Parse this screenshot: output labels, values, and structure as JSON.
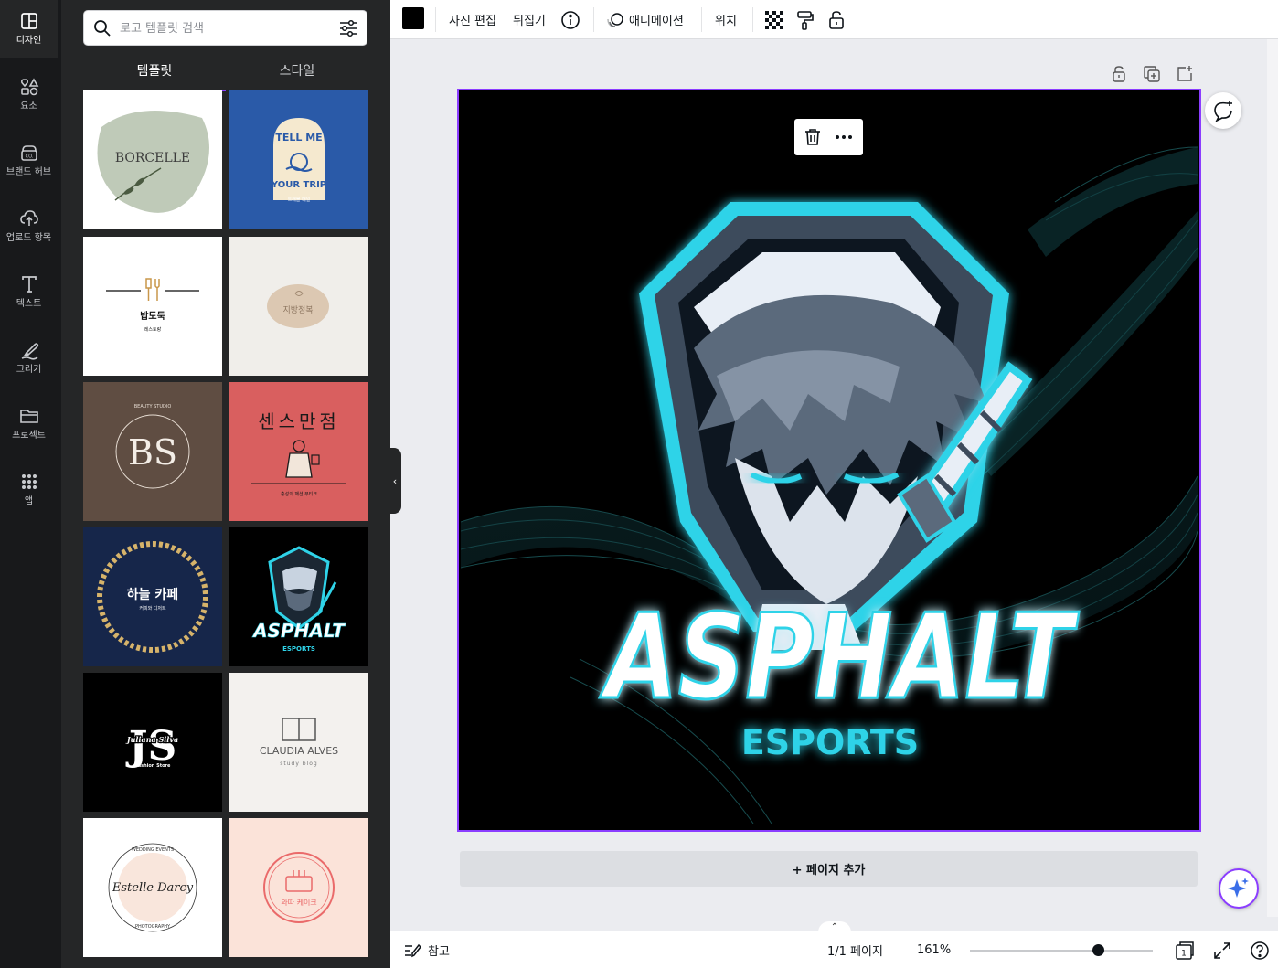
{
  "rail": {
    "items": [
      {
        "label": "디자인",
        "icon": "design-icon",
        "active": true
      },
      {
        "label": "요소",
        "icon": "elements-icon"
      },
      {
        "label": "브랜드 허브",
        "icon": "brand-hub-icon"
      },
      {
        "label": "업로드 항목",
        "icon": "upload-icon"
      },
      {
        "label": "텍스트",
        "icon": "text-icon"
      },
      {
        "label": "그리기",
        "icon": "draw-icon"
      },
      {
        "label": "프로젝트",
        "icon": "folder-icon"
      },
      {
        "label": "앱",
        "icon": "apps-icon"
      }
    ]
  },
  "panel": {
    "search_placeholder": "로고 템플릿 검색",
    "tabs": [
      {
        "label": "템플릿",
        "active": true
      },
      {
        "label": "스타일",
        "active": false
      }
    ],
    "templates": [
      {
        "name": "borcelle",
        "texts": [
          "BORCELLE"
        ],
        "bg": "#ffffff"
      },
      {
        "name": "tell-me-your-trip",
        "texts": [
          "TELL ME",
          "YOUR TRIP",
          "트래블 매일"
        ],
        "bg": "#2a5aa8"
      },
      {
        "name": "bap-doduk",
        "texts": [
          "밥도둑",
          "레스토랑"
        ],
        "bg": "#ffffff"
      },
      {
        "name": "jibang-jeongbuk",
        "texts": [
          "지방정복"
        ],
        "bg": "#f0eeea"
      },
      {
        "name": "bs-beauty",
        "texts": [
          "BS",
          "BEAUTY STUDIO"
        ],
        "bg": "#5f4d42"
      },
      {
        "name": "sense-manjeom",
        "texts": [
          "센스만점",
          "충성의 패션 부티크"
        ],
        "bg": "#d95f5f"
      },
      {
        "name": "haneul-cafe",
        "texts": [
          "하늘 카페",
          "커피와 디저트"
        ],
        "bg": "#16264a"
      },
      {
        "name": "asphalt-esports-thumb",
        "texts": [
          "ASPHALT",
          "ESPORTS"
        ],
        "bg": "#000000"
      },
      {
        "name": "juliana-silva",
        "texts": [
          "JS",
          "Juliana Silva",
          "Fashion Store"
        ],
        "bg": "#000000"
      },
      {
        "name": "claudia-alves",
        "texts": [
          "CLAUDIA ALVES",
          "study blog"
        ],
        "bg": "#f3f1ee"
      },
      {
        "name": "estelle-darcy",
        "texts": [
          "Estelle Darcy",
          "WEDDING EVENTS",
          "PHOTOGRAPHY"
        ],
        "bg": "#ffffff"
      },
      {
        "name": "wadda-cake",
        "texts": [
          "와따 케이크"
        ],
        "bg": "#fbe3d9"
      }
    ]
  },
  "toolbar": {
    "color_swatch": "#000000",
    "photo_edit": "사진 편집",
    "flip": "뒤집기",
    "animation": "애니메이션",
    "position": "위치"
  },
  "canvas": {
    "title": "ASPHALT",
    "subtitle": "ESPORTS",
    "accent": "#2fd3e8",
    "add_page": "+ 페이지 추가"
  },
  "bottom": {
    "notes": "참고",
    "page_indicator": "1/1 페이지",
    "zoom": "161%",
    "zoom_fraction": 0.7,
    "page_count_badge": "1"
  }
}
